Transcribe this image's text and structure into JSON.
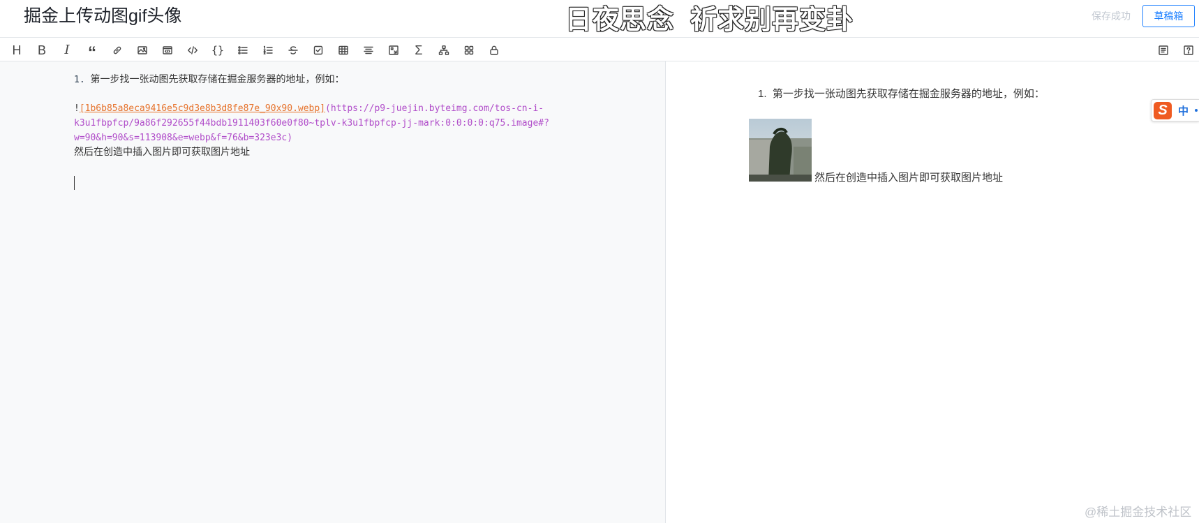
{
  "header": {
    "title": "掘金上传动图gif头像",
    "overlay_text": "日夜思念  祈求别再变卦",
    "save_status": "保存成功",
    "draft_label": "草稿箱"
  },
  "toolbar": {
    "tools": [
      "heading-icon",
      "bold-icon",
      "italic-icon",
      "quote-icon",
      "link-icon",
      "image-icon",
      "html-icon",
      "code-icon",
      "code-block-icon",
      "unordered-list-icon",
      "ordered-list-icon",
      "strikethrough-icon",
      "task-list-icon",
      "table-icon",
      "align-icon",
      "fullscreen-icon",
      "formula-icon",
      "mindmap-icon",
      "grid-icon",
      "lock-icon"
    ],
    "right_tools": [
      "toc-icon",
      "help-icon"
    ]
  },
  "editor": {
    "line1_num": "1.",
    "line1_text": "第一步找一张动图先获取存储在掘金服务器的地址，例如：",
    "md_bang": "!",
    "md_alt": "[1b6b85a8eca9416e5c9d3e8b3d8fe87e_90x90.webp]",
    "md_url_1": "(https://p9-juejin.byteimg.com/tos-cn-i-",
    "md_url_2": "k3u1fbpfcp/9a86f292655f44bdb1911403f60e0f80~tplv-k3u1fbpfcp-jj-mark:0:0:0:0:q75.image#?",
    "md_url_3": "w=90&h=90&s=113908&e=webp&f=76&b=323e3c)",
    "line_after": "然后在创造中插入图片即可获取图片地址"
  },
  "preview": {
    "item_num": "1.",
    "item_text": "第一步找一张动图先获取存储在掘金服务器的地址，例如：",
    "after_text": "然后在创造中插入图片即可获取图片地址"
  },
  "ime": {
    "logo": "S",
    "lang": "中"
  },
  "watermark": "@稀土掘金技术社区"
}
